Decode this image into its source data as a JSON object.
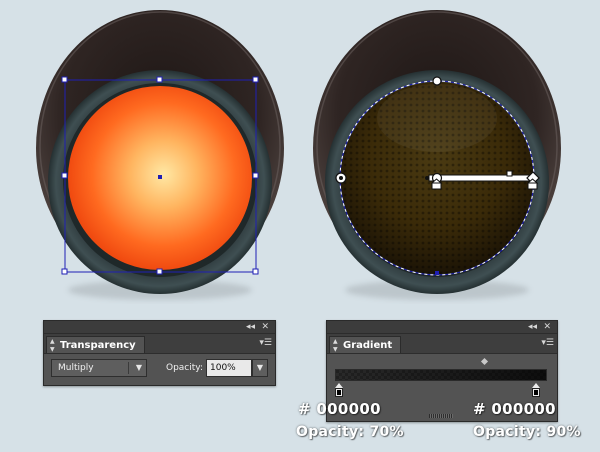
{
  "colors": {
    "background": "#d6e1e7",
    "panel": "#535353",
    "selection": "#1f1fb4",
    "glow_center": "#ffe8a4",
    "glow_edge": "#ff5010",
    "dark_lens": "#3e2c0a"
  },
  "transparency_panel": {
    "title": "Transparency",
    "collapse_icon": "double-chevron-left-icon",
    "close_icon": "close-icon",
    "menu_icon": "panel-menu-icon",
    "blend_mode": "Multiply",
    "opacity_label": "Opacity:",
    "opacity_value": "100%"
  },
  "gradient_panel": {
    "title": "Gradient",
    "collapse_icon": "double-chevron-left-icon",
    "close_icon": "close-icon",
    "menu_icon": "panel-menu-icon",
    "stops": [
      {
        "color": "#000000",
        "opacity": 0.7
      },
      {
        "color": "#000000",
        "opacity": 0.9
      }
    ]
  },
  "annotations": {
    "left_hex": "# 000000",
    "left_opacity": "Opacity: 70%",
    "right_hex": "# 000000",
    "right_opacity": "Opacity: 90%"
  }
}
